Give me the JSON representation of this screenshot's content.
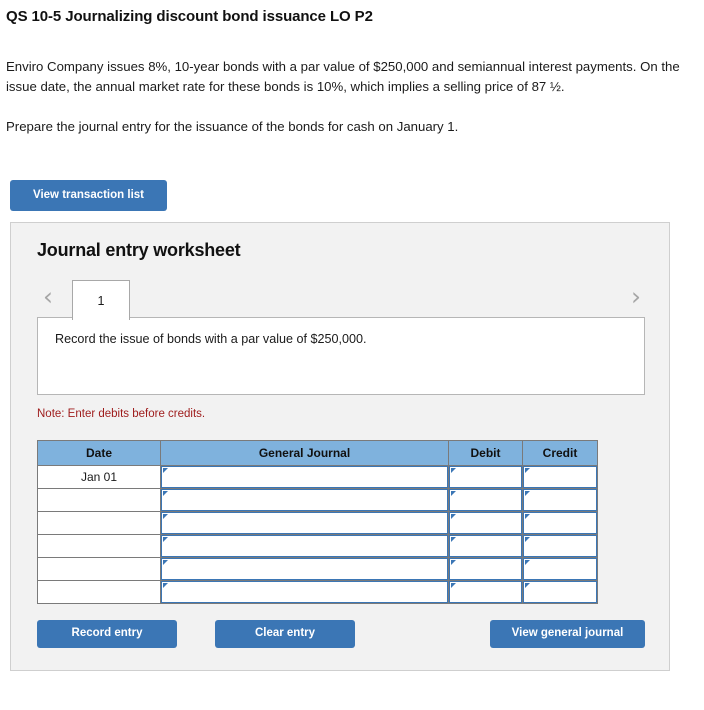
{
  "question": {
    "title": "QS 10-5 Journalizing discount bond issuance LO P2",
    "paragraph1": "Enviro Company issues 8%, 10-year bonds with a par value of $250,000 and semiannual interest payments. On the issue date, the annual market rate for these bonds is 10%, which implies a selling price of 87 ½.",
    "paragraph2": "Prepare the journal entry for the issuance of the bonds for cash on January 1."
  },
  "toolbar": {
    "view_transaction_list_label": "View transaction list"
  },
  "worksheet": {
    "title": "Journal entry worksheet",
    "prev_icon": "chevron-left-icon",
    "next_icon": "chevron-right-icon",
    "tabs": [
      {
        "label": "1",
        "active": true
      }
    ],
    "description": "Record the issue of bonds with a par value of $250,000.",
    "note": "Note: Enter debits before credits.",
    "table": {
      "headers": [
        "Date",
        "General Journal",
        "Debit",
        "Credit"
      ],
      "rows": [
        {
          "date": "Jan 01",
          "general_journal": "",
          "debit": "",
          "credit": ""
        },
        {
          "date": "",
          "general_journal": "",
          "debit": "",
          "credit": ""
        },
        {
          "date": "",
          "general_journal": "",
          "debit": "",
          "credit": ""
        },
        {
          "date": "",
          "general_journal": "",
          "debit": "",
          "credit": ""
        },
        {
          "date": "",
          "general_journal": "",
          "debit": "",
          "credit": ""
        },
        {
          "date": "",
          "general_journal": "",
          "debit": "",
          "credit": ""
        }
      ]
    },
    "actions": {
      "record_entry_label": "Record entry",
      "clear_entry_label": "Clear entry",
      "view_general_journal_label": "View general journal"
    }
  },
  "colors": {
    "button_blue": "#3b76b5",
    "table_header_blue": "#7fb2dd",
    "panel_gray": "#f2f2f2",
    "note_red": "#9e1b1b",
    "cell_border_blue": "#3b76b5"
  }
}
